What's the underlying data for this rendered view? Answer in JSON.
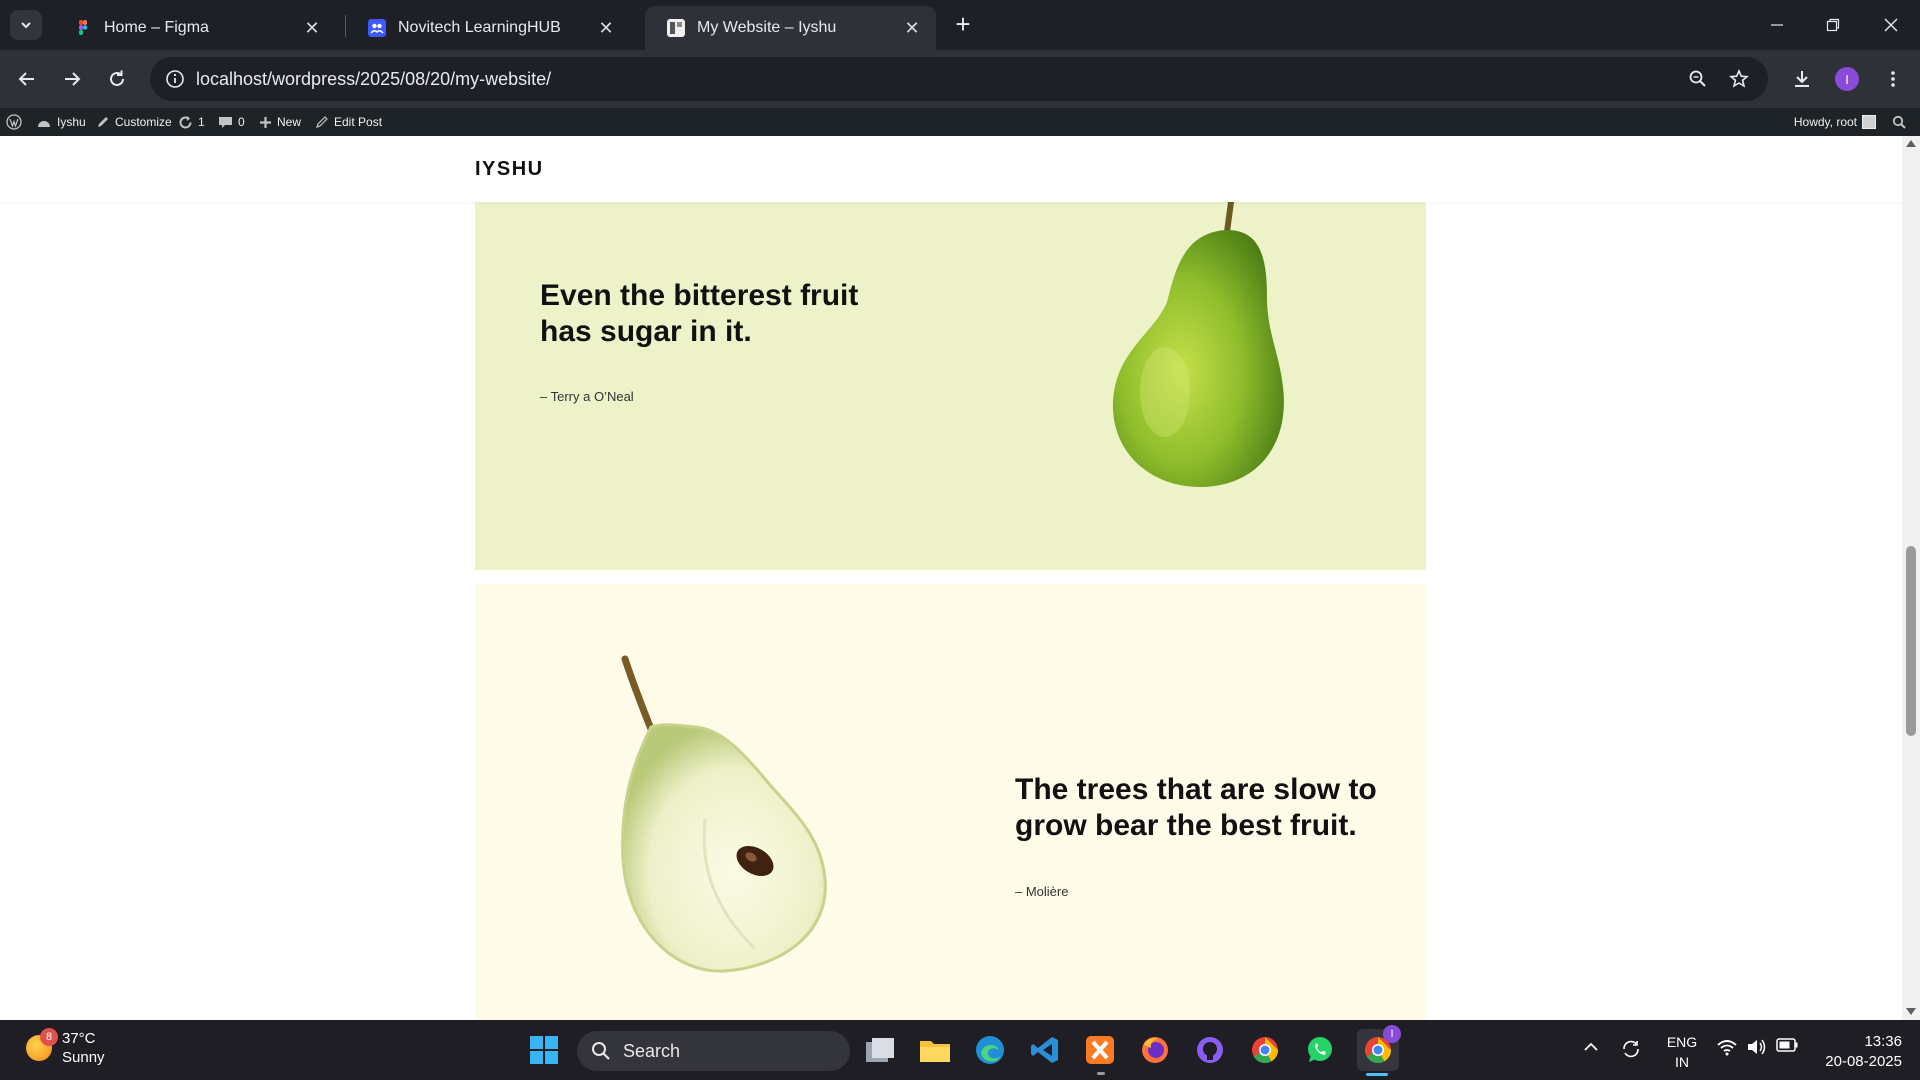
{
  "browser": {
    "tabs": [
      {
        "title": "Home – Figma",
        "active": false
      },
      {
        "title": "Novitech LearningHUB",
        "active": false
      },
      {
        "title": "My Website – Iyshu",
        "active": true
      }
    ],
    "url": "localhost/wordpress/2025/08/20/my-website/",
    "profile_initial": "I"
  },
  "adminbar": {
    "site_name": "Iyshu",
    "customize": "Customize",
    "updates_count": "1",
    "comments_count": "0",
    "new_label": "New",
    "edit_post": "Edit Post",
    "howdy": "Howdy, root"
  },
  "site": {
    "title": "IYSHU",
    "quotes": [
      {
        "text": "Even the bitterest fruit has sugar in it.",
        "author": "– Terry a O’Neal"
      },
      {
        "text": "The trees that are slow to grow bear the best fruit.",
        "author": "– Molière"
      }
    ]
  },
  "taskbar": {
    "weather_temp": "37°C",
    "weather_desc": "Sunny",
    "weather_badge": "8",
    "search_placeholder": "Search",
    "lang_line1": "ENG",
    "lang_line2": "IN",
    "time": "13:36",
    "date": "20-08-2025",
    "chrome_badge": "I"
  },
  "colors": {
    "quote_block_1": "#eef2c8",
    "quote_block_2": "#fefbe9",
    "admin_bar": "#1d2327",
    "tabbar": "#1f2027"
  }
}
